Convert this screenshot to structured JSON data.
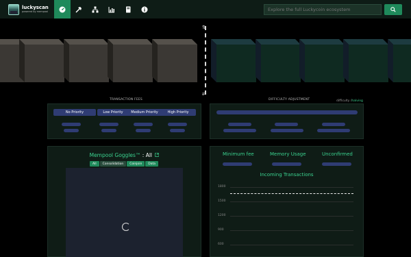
{
  "brand": {
    "title": "luckyscan",
    "subtitle": "powered by mempool"
  },
  "nav": {
    "items": [
      {
        "name": "nav-dashboard",
        "icon": "tachometer-icon",
        "active": true
      },
      {
        "name": "nav-mining",
        "icon": "hammer-icon",
        "active": false
      },
      {
        "name": "nav-lightning-nodes",
        "icon": "network-icon",
        "active": false
      },
      {
        "name": "nav-graphs",
        "icon": "chart-icon",
        "active": false
      },
      {
        "name": "nav-docs",
        "icon": "book-icon",
        "active": false
      },
      {
        "name": "nav-about",
        "icon": "info-icon",
        "active": false
      }
    ]
  },
  "search": {
    "placeholder": "Explore the full Luckycoin ecosystem",
    "button_icon": "search-icon"
  },
  "sections": {
    "fees_title": "TRANSACTION FEES",
    "difficulty_title": "DIFFICULTY ADJUSTMENT",
    "difficulty_tag_label": "difficulty /",
    "difficulty_tag_value": "halving"
  },
  "fees": {
    "headers": [
      "No Priority",
      "Low Priority",
      "Medium Priority",
      "High Priority"
    ]
  },
  "goggles": {
    "title": "Mempool Goggles™",
    "suffix": " : All",
    "tabs": [
      "All",
      "Consolidation",
      "Coinjoin",
      "Data"
    ],
    "selected_tab": "Consolidation"
  },
  "stats": {
    "labels": [
      "Minimum fee",
      "Memory Usage",
      "Unconfirmed"
    ],
    "incoming_title": "Incoming Transactions",
    "yticks": [
      "1800",
      "1500",
      "1200",
      "900",
      "600"
    ]
  },
  "colors": {
    "accent": "#3bd28f",
    "nav_active": "#1f8a5b",
    "placeholder_bar": "#2f3c73",
    "panel_bg": "#0f1c16"
  }
}
